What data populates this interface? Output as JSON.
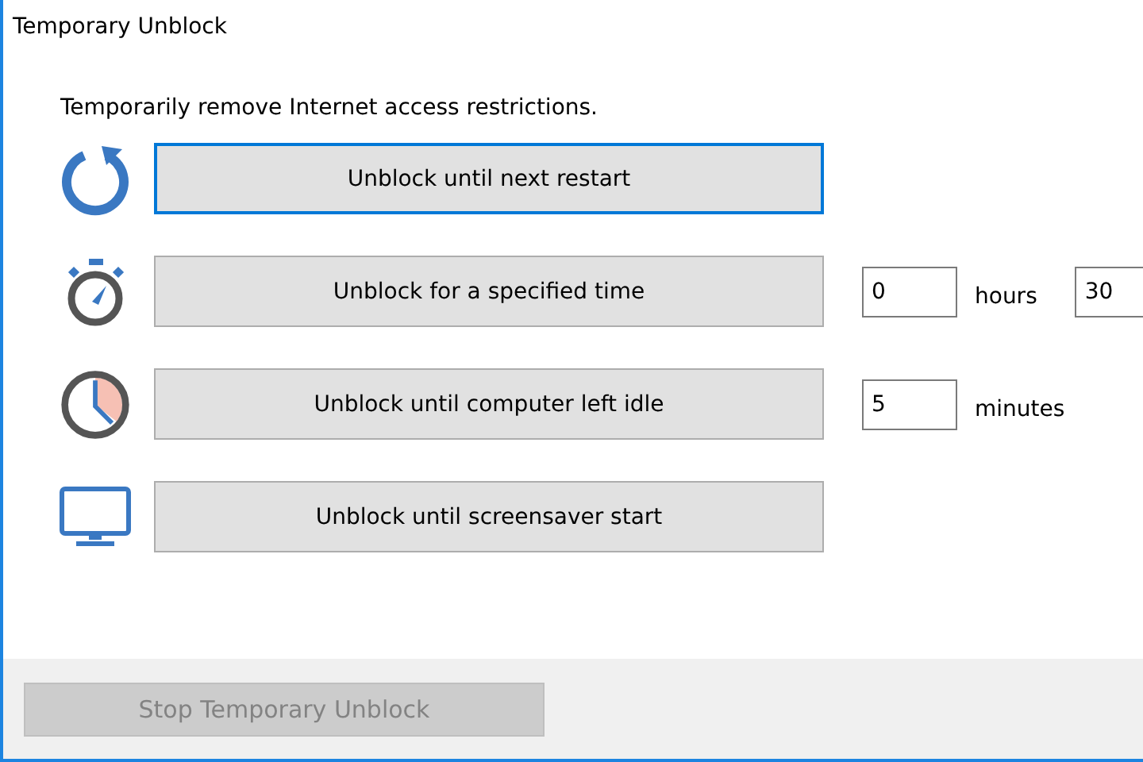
{
  "window": {
    "title": "Temporary Unblock"
  },
  "description": "Temporarily remove Internet access restrictions.",
  "options": [
    {
      "kind": "restart",
      "label": "Unblock until next restart",
      "focused": true
    },
    {
      "kind": "stopwatch",
      "label": "Unblock for a specified time",
      "focused": false,
      "inputs": [
        {
          "value": "0",
          "unit": "hours"
        },
        {
          "value": "30"
        }
      ]
    },
    {
      "kind": "clock",
      "label": "Unblock until computer left idle",
      "focused": false,
      "inputs": [
        {
          "value": "5",
          "unit": "minutes"
        }
      ]
    },
    {
      "kind": "monitor",
      "label": "Unblock until screensaver start",
      "focused": false
    }
  ],
  "stop_button": {
    "label": "Stop Temporary Unblock",
    "disabled": true
  }
}
